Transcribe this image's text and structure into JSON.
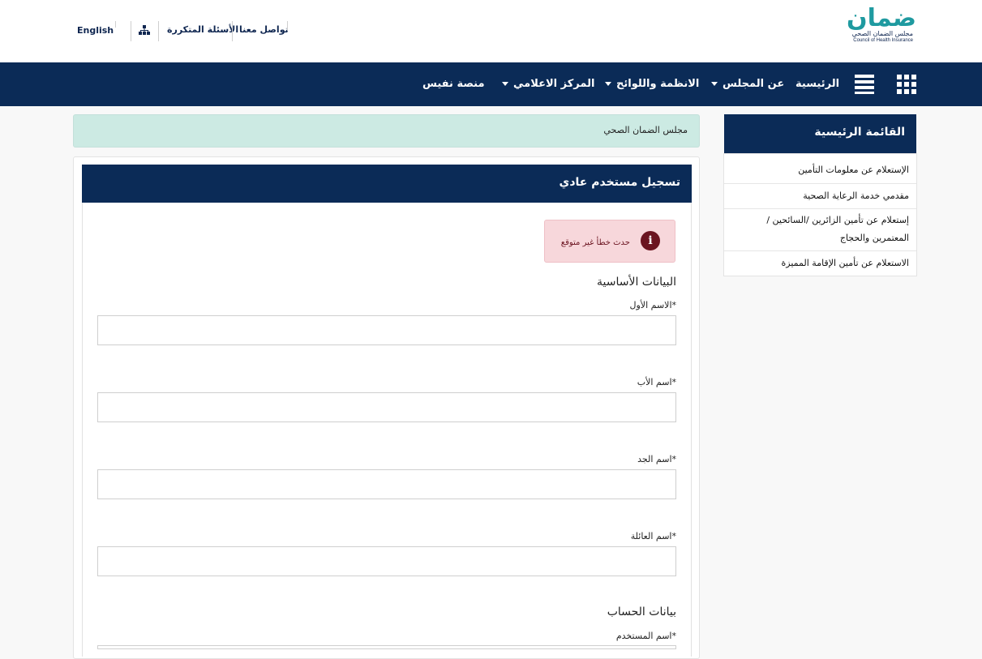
{
  "header": {
    "logo_main": "ضمان",
    "logo_sub_ar": "مجلس الضمان الصحي",
    "logo_sub_en": "Council of Health Insurance",
    "util_links": {
      "english": "English",
      "faq": "الأسئلة المتكررة",
      "contact": "تواصل معنا"
    }
  },
  "nav": {
    "items": [
      {
        "label": "الرئيسية"
      },
      {
        "label": "عن المجلس"
      },
      {
        "label": "الانظمة واللوائح"
      },
      {
        "label": "المركز الاعلامي"
      },
      {
        "label": "منصة نفيس"
      }
    ]
  },
  "breadcrumb": "مجلس الضمان الصحي",
  "form": {
    "title": "تسجيل مستخدم عادي",
    "alert": "حدث خطأ غير متوقع",
    "basic_section": "البيانات الأساسية",
    "account_section": "بيانات الحساب",
    "fields": {
      "first_name": "الاسم الأول*",
      "father_name": "اسم الأب*",
      "grandfather_name": "اسم الجد*",
      "family_name": "اسم العائلة*",
      "username": "اسم المستخدم*"
    }
  },
  "sidebar": {
    "title": "القائمة الرئيسية",
    "items": [
      {
        "label": "الإستعلام عن معلومات التأمين"
      },
      {
        "label": "مقدمي خدمة الرعاية الصحية"
      },
      {
        "label": "إستعلام عن تأمين الزائرين /السائحين / المعتمرين والحجاج"
      },
      {
        "label": "الاستعلام عن تأمين الإقامة المميزة"
      }
    ]
  },
  "colors": {
    "navy": "#0b2b57",
    "teal_logo": "#1f9aa0",
    "alert_bg": "#f7d7db",
    "crumb_bg": "#cceae3"
  },
  "icons": [
    "grid-icon",
    "list-icon",
    "sitemap-icon",
    "info-icon",
    "caret-down-icon"
  ]
}
